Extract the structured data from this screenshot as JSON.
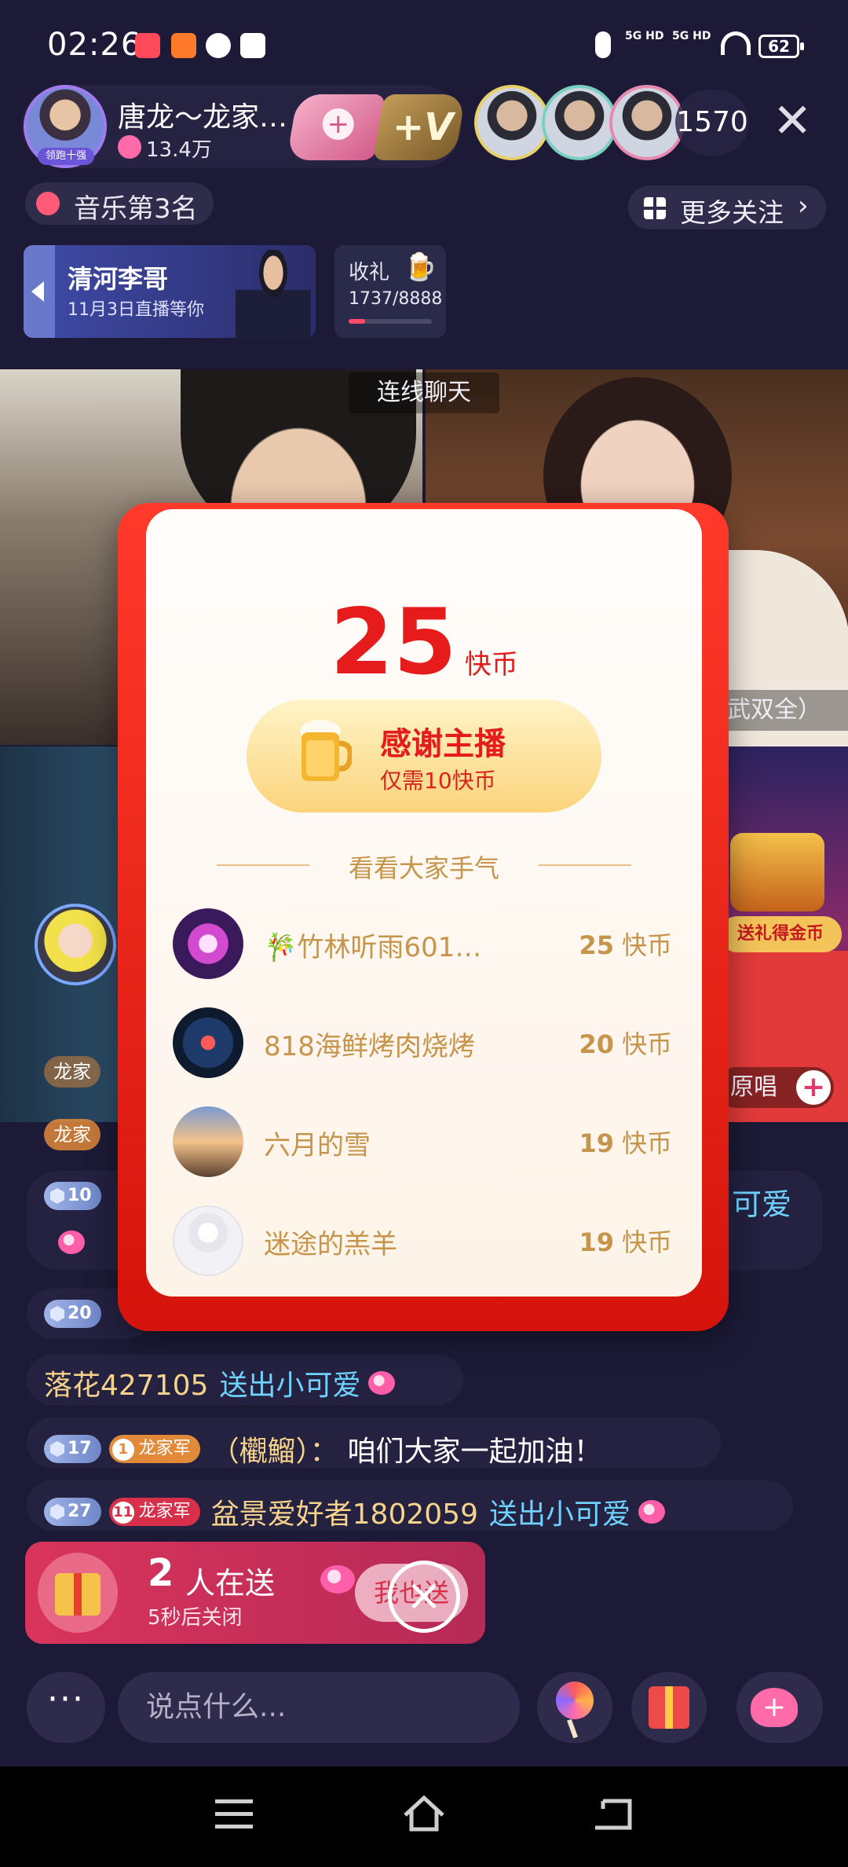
{
  "status_bar": {
    "time": "02:26",
    "battery": "62",
    "signal1": "5G HD",
    "signal2": "5G HD"
  },
  "host": {
    "name": "唐龙～龙家…",
    "likes": "13.4万",
    "badge": "领跑十强",
    "viewers": "1570"
  },
  "tags": {
    "music_rank": "音乐第3名",
    "more_follow": "更多关注"
  },
  "banner": {
    "title": "清河李哥",
    "subtitle": "11月3日直播等你"
  },
  "gift_goal": {
    "label": "收礼",
    "progress_text": "1737/8888",
    "progress": 0.195
  },
  "video": {
    "section_label": "连线聊天",
    "top_right_label": "武双全）",
    "treasure_label": "送礼得金币",
    "sing_label": "原唱"
  },
  "chat": [
    {
      "level": "10",
      "fan_level": "1",
      "fan_label": "龙家",
      "name": "",
      "text": "可爱"
    },
    {
      "level": "20",
      "name": ""
    },
    {
      "name": "落花427105",
      "action": "送出小可爱"
    },
    {
      "level": "17",
      "fan_level": "1",
      "fan_label": "龙家军",
      "name": "（欟鰡）：",
      "text": "咱们大家一起加油！"
    },
    {
      "level": "27",
      "fan_level": "11",
      "fan_label": "龙家军",
      "name": "盆景爱好者1802059",
      "action": "送出小可爱"
    }
  ],
  "side_labels": {
    "fan1": "龙家",
    "fan2": "龙家"
  },
  "popup": {
    "amount": "25",
    "unit": "快币",
    "thanks_title": "感谢主播",
    "thanks_sub": "仅需10快币",
    "section_title": "看看大家手气",
    "ranks": [
      {
        "name": "🎋竹林听雨601…",
        "amount": "25",
        "unit": "快币"
      },
      {
        "name": "818海鲜烤肉烧烤",
        "amount": "20",
        "unit": "快币"
      },
      {
        "name": "六月的雪",
        "amount": "19",
        "unit": "快币"
      },
      {
        "name": "迷途的羔羊",
        "amount": "19",
        "unit": "快币"
      }
    ]
  },
  "send_banner": {
    "count": "2",
    "label": "人在送",
    "sub": "5秒后关闭",
    "button": "我也送"
  },
  "input": {
    "placeholder": "说点什么...",
    "more": "···"
  },
  "colors": {
    "accent_red": "#e61b1b",
    "gold_text": "#c6944a",
    "background": "#1c1a36"
  }
}
